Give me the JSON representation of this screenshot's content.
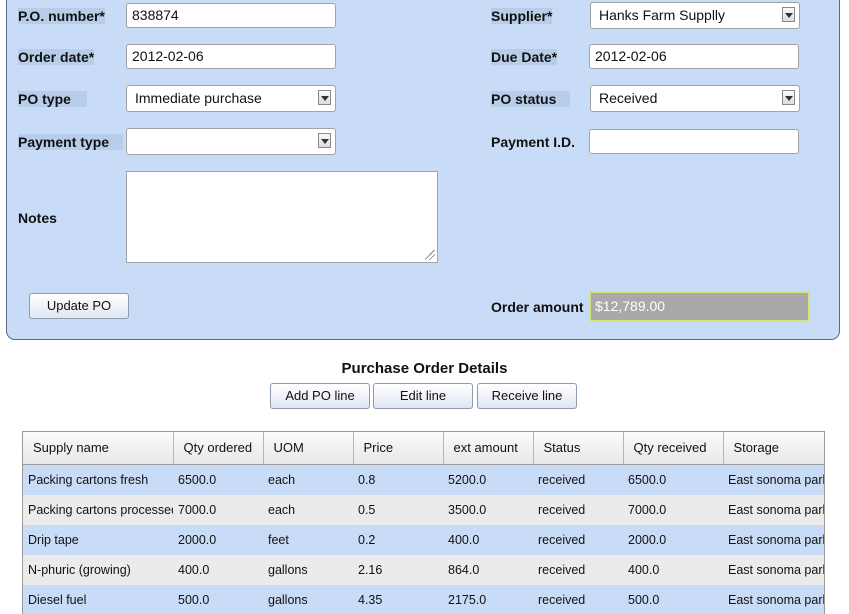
{
  "form": {
    "po_number": {
      "label": "P.O. number*",
      "value": "838874"
    },
    "supplier": {
      "label": "Supplier*",
      "value": "Hanks Farm Supplly"
    },
    "order_date": {
      "label": "Order date*",
      "value": "2012-02-06"
    },
    "due_date": {
      "label": "Due Date*",
      "value": "2012-02-06"
    },
    "po_type": {
      "label": "PO type",
      "value": "Immediate purchase"
    },
    "po_status": {
      "label": "PO status",
      "value": "Received"
    },
    "payment_type": {
      "label": "Payment type",
      "value": ""
    },
    "payment_id": {
      "label": "Payment I.D.",
      "value": ""
    },
    "notes": {
      "label": "Notes",
      "value": ""
    },
    "update_button": "Update PO",
    "order_amount": {
      "label": "Order amount",
      "value": "$12,789.00"
    }
  },
  "details": {
    "title": "Purchase Order Details",
    "buttons": {
      "add": "Add PO line",
      "edit": "Edit line",
      "receive": "Receive line"
    },
    "columns": [
      "Supply name",
      "Qty ordered",
      "UOM",
      "Price",
      "ext amount",
      "Status",
      "Qty received",
      "Storage"
    ],
    "rows": [
      [
        "Packing cartons fresh",
        "6500.0",
        "each",
        "0.8",
        "5200.0",
        "received",
        "6500.0",
        "East sonoma park"
      ],
      [
        "Packing cartons processed",
        "7000.0",
        "each",
        "0.5",
        "3500.0",
        "received",
        "7000.0",
        "East sonoma park"
      ],
      [
        "Drip tape",
        "2000.0",
        "feet",
        "0.2",
        "400.0",
        "received",
        "2000.0",
        "East sonoma park"
      ],
      [
        "N-phuric (growing)",
        "400.0",
        "gallons",
        "2.16",
        "864.0",
        "received",
        "400.0",
        "East sonoma park"
      ],
      [
        "Diesel fuel",
        "500.0",
        "gallons",
        "4.35",
        "2175.0",
        "received",
        "500.0",
        "East sonoma park"
      ]
    ]
  }
}
